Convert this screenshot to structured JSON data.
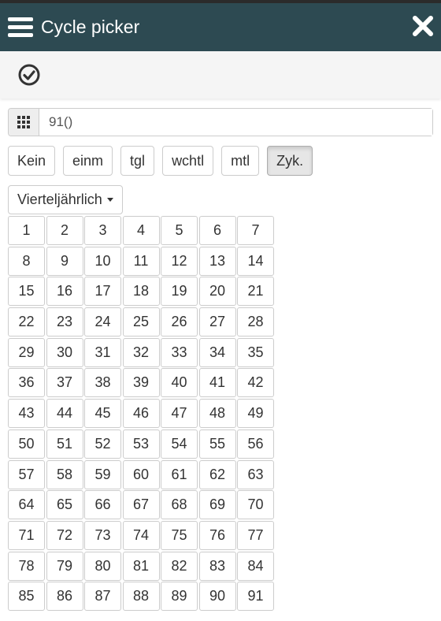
{
  "header": {
    "title": "Cycle picker"
  },
  "icons": {
    "menu": "hamburger-icon",
    "close": "close-icon",
    "confirm": "check-circle-icon",
    "grid": "grid-icon"
  },
  "colors": {
    "header_bg": "#2d4a52",
    "active_button_bg": "#e6e6e6"
  },
  "input": {
    "value": "91()"
  },
  "cycle_buttons": [
    {
      "label": "Kein",
      "active": false
    },
    {
      "label": "einm",
      "active": false
    },
    {
      "label": "tgl",
      "active": false
    },
    {
      "label": "wchtl",
      "active": false
    },
    {
      "label": "mtl",
      "active": false
    },
    {
      "label": "Zyk.",
      "active": true
    }
  ],
  "period_dropdown": {
    "selected": "Vierteljährlich"
  },
  "day_grid": [
    "1",
    "2",
    "3",
    "4",
    "5",
    "6",
    "7",
    "8",
    "9",
    "10",
    "11",
    "12",
    "13",
    "14",
    "15",
    "16",
    "17",
    "18",
    "19",
    "20",
    "21",
    "22",
    "23",
    "24",
    "25",
    "26",
    "27",
    "28",
    "29",
    "30",
    "31",
    "32",
    "33",
    "34",
    "35",
    "36",
    "37",
    "38",
    "39",
    "40",
    "41",
    "42",
    "43",
    "44",
    "45",
    "46",
    "47",
    "48",
    "49",
    "50",
    "51",
    "52",
    "53",
    "54",
    "55",
    "56",
    "57",
    "58",
    "59",
    "60",
    "61",
    "62",
    "63",
    "64",
    "65",
    "66",
    "67",
    "68",
    "69",
    "70",
    "71",
    "72",
    "73",
    "74",
    "75",
    "76",
    "77",
    "78",
    "79",
    "80",
    "81",
    "82",
    "83",
    "84",
    "85",
    "86",
    "87",
    "88",
    "89",
    "90",
    "91"
  ]
}
